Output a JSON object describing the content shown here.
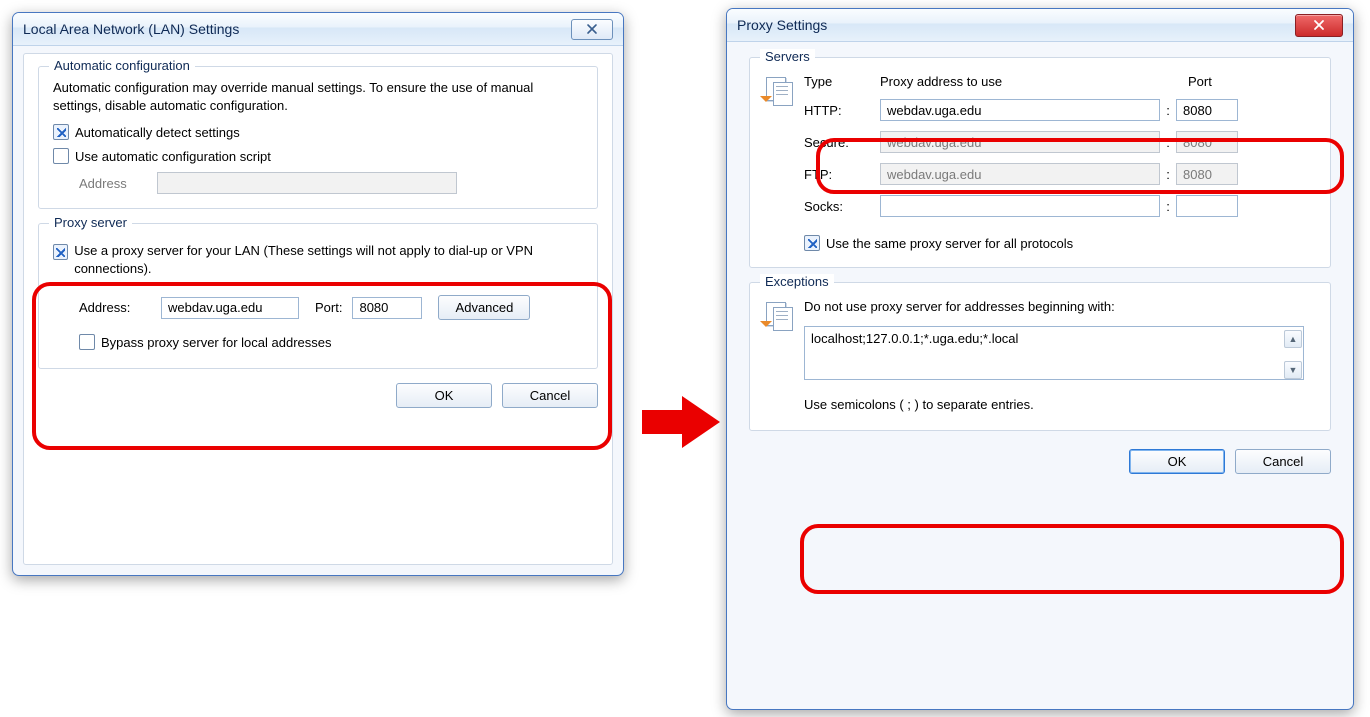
{
  "lan": {
    "title": "Local Area Network (LAN) Settings",
    "auto_group": "Automatic configuration",
    "auto_desc": "Automatic configuration may override manual settings.  To ensure the use of manual settings, disable automatic configuration.",
    "auto_detect": "Automatically detect settings",
    "auto_script": "Use automatic configuration script",
    "address_lbl": "Address",
    "address_val": "",
    "proxy_group": "Proxy server",
    "proxy_use": "Use a proxy server for your LAN (These settings will not apply to dial-up or VPN connections).",
    "proxy_addr_lbl": "Address:",
    "proxy_addr_val": "webdav.uga.edu",
    "proxy_port_lbl": "Port:",
    "proxy_port_val": "8080",
    "advanced": "Advanced",
    "bypass_local": "Bypass proxy server for local addresses",
    "ok": "OK",
    "cancel": "Cancel"
  },
  "proxy": {
    "title": "Proxy Settings",
    "servers_group": "Servers",
    "col_type": "Type",
    "col_addr": "Proxy address to use",
    "col_port": "Port",
    "rows": {
      "http": {
        "label": "HTTP:",
        "addr": "webdav.uga.edu",
        "port": "8080",
        "enabled": true
      },
      "secure": {
        "label": "Secure:",
        "addr": "webdav.uga.edu",
        "port": "8080",
        "enabled": false
      },
      "ftp": {
        "label": "FTP:",
        "addr": "webdav.uga.edu",
        "port": "8080",
        "enabled": false
      },
      "socks": {
        "label": "Socks:",
        "addr": "",
        "port": "",
        "enabled": true
      }
    },
    "same_all": "Use the same proxy server for all protocols",
    "exceptions_group": "Exceptions",
    "exceptions_desc": "Do not use proxy server for addresses beginning with:",
    "exceptions_val": "localhost;127.0.0.1;*.uga.edu;*.local ",
    "exceptions_hint": "Use semicolons ( ; ) to separate entries.",
    "ok": "OK",
    "cancel": "Cancel"
  }
}
